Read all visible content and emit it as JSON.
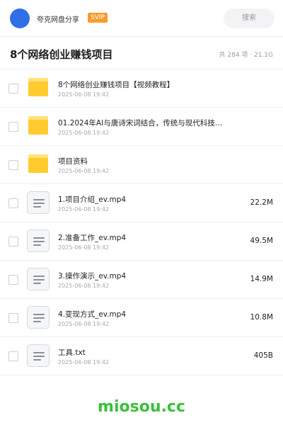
{
  "header": {
    "username": "夸克网盘分享",
    "badge": "SVIP",
    "search_placeholder": "搜索",
    "accent_color": "#2f6fe8"
  },
  "folder": {
    "title": "8个网络创业赚钱项目",
    "meta": "共 284 项 · 21.1G"
  },
  "files": [
    {
      "name": "8个网络创业赚钱项目【视频教程】",
      "date": "2025-06-08 19:42",
      "size": "",
      "icon": "folder-icon"
    },
    {
      "name": "01.2024年AI与唐诗宋词结合，传统与现代科技…",
      "date": "2025-06-08 19:42",
      "size": "",
      "icon": "folder-icon"
    },
    {
      "name": "项目资料",
      "date": "2025-06-08 19:42",
      "size": "",
      "icon": "folder-icon"
    },
    {
      "name": "1.项目介绍_ev.mp4",
      "date": "2025-06-08 19:42",
      "size": "22.2M",
      "icon": "file-icon"
    },
    {
      "name": "2.准备工作_ev.mp4",
      "date": "2025-06-08 19:42",
      "size": "49.5M",
      "icon": "file-icon"
    },
    {
      "name": "3.操作演示_ev.mp4",
      "date": "2025-06-08 19:42",
      "size": "14.9M",
      "icon": "file-icon"
    },
    {
      "name": "4.变现方式_ev.mp4",
      "date": "2025-06-08 19:42",
      "size": "10.8M",
      "icon": "file-icon"
    },
    {
      "name": "工具.txt",
      "date": "2025-06-08 19:42",
      "size": "405B",
      "icon": "file-icon"
    }
  ],
  "watermark": "miosou.cc"
}
